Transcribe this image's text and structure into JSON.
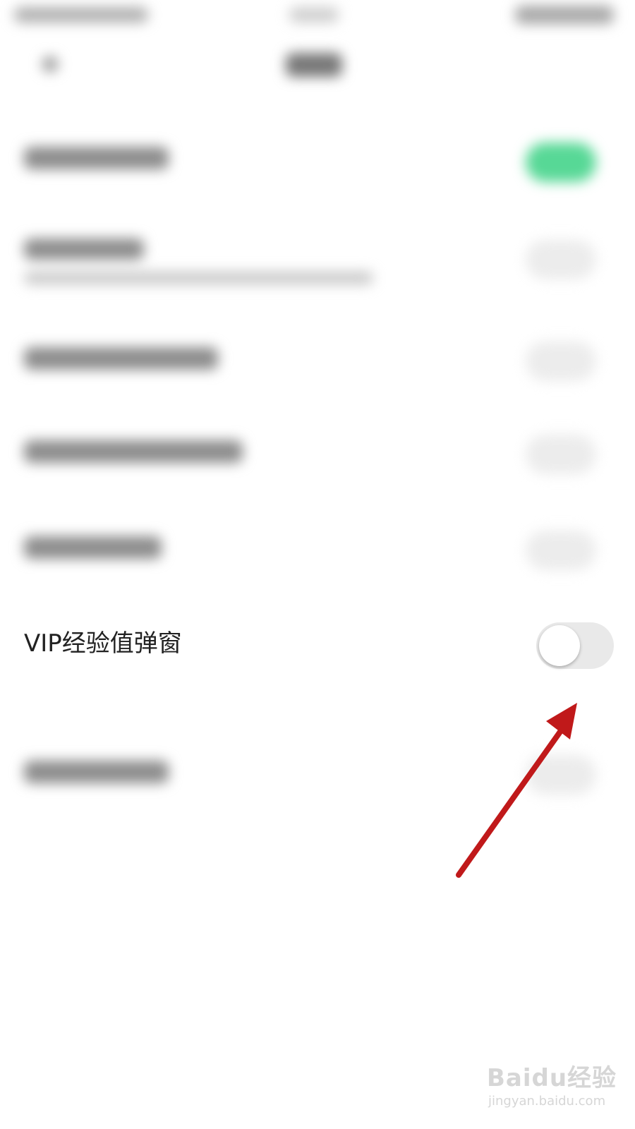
{
  "settings": {
    "vip_row": {
      "label": "VIP经验值弹窗",
      "toggle_state": "off"
    }
  },
  "colors": {
    "toggle_on": "#57d896",
    "toggle_off": "#e9e9e9",
    "arrow": "#c0191a"
  },
  "watermark": {
    "brand": "Baidu经验",
    "url": "jingyan.baidu.com"
  }
}
